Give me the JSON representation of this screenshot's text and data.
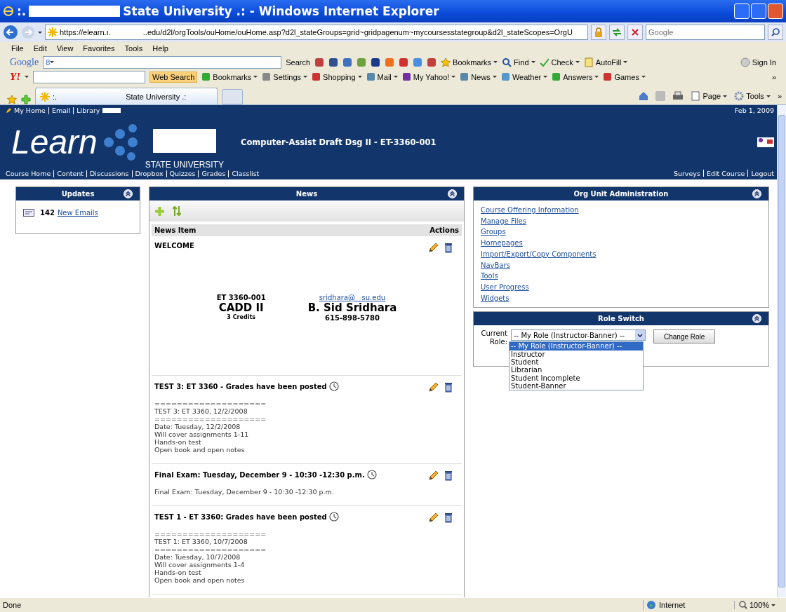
{
  "window": {
    "title_prefix": ":.",
    "title": "State University .: - Windows Internet Explorer"
  },
  "address_bar": {
    "url_start": "https://elearn.ı.",
    "url_rest": "..edu/d2l/orgTools/ouHome/ouHome.asp?d2l_stateGroups=grid~gridpagenum~mycoursesstategroup&d2l_stateScopes=OrgU",
    "search_placeholder": "Google"
  },
  "menu": [
    "File",
    "Edit",
    "View",
    "Favorites",
    "Tools",
    "Help"
  ],
  "google_toolbar": {
    "logo": "Google",
    "field_label": "8",
    "search": "Search",
    "items": [
      "Bookmarks",
      "Find",
      "Check",
      "AutoFill"
    ],
    "sign_in": "Sign In"
  },
  "yahoo_toolbar": {
    "logo": "Y!",
    "search": "Web Search",
    "items": [
      "Bookmarks",
      "Settings",
      "Shopping",
      "Mail",
      "My Yahoo!",
      "News",
      "Weather",
      "Answers",
      "Games"
    ],
    "more": "»"
  },
  "tabs": [
    {
      "prefix": ":.",
      "label": "State University .:",
      "selected": true
    }
  ],
  "command_bar": {
    "items": [
      "Page",
      "Tools"
    ],
    "more": "»"
  },
  "site_header": {
    "top_links": [
      "My Home",
      "Email",
      "Library"
    ],
    "date": "Feb 1, 2009",
    "logo": "Learn",
    "university": "STATE UNIVERSITY",
    "course_title": "Computer-Assist Draft Dsg II - ET-3360-001",
    "nav": [
      "Course Home",
      "Content",
      "Discussions",
      "Dropbox",
      "Quizzes",
      "Grades",
      "Classlist"
    ],
    "nav_right": [
      "Surveys",
      "Edit Course",
      "Logout"
    ]
  },
  "updates": {
    "title": "Updates",
    "count": "142",
    "link": "New Emails"
  },
  "news": {
    "title": "News",
    "columns": [
      "News Item",
      "Actions"
    ],
    "items": [
      {
        "kind": "welcome",
        "title": "WELCOME",
        "course_code": "ET 3360-001",
        "course_name": "CADD II",
        "credits": "3 Credits",
        "email": "sridhara@   su.edu",
        "instructor": "B. Sid Sridhara",
        "phone": "615-898-5780"
      },
      {
        "kind": "post",
        "title": "TEST 3: ET 3360 - Grades have been posted",
        "lines": [
          "====================",
          "TEST 3: ET 3360, 12/2/2008",
          "====================",
          "Date: Tuesday, 12/2/2008",
          "Will cover assignments 1-11",
          "Hands-on test",
          "Open book and open notes"
        ]
      },
      {
        "kind": "post",
        "title": "Final Exam: Tuesday, December 9 - 10:30 -12:30 p.m.",
        "lines": [
          "Final Exam: Tuesday, December 9 - 10:30 -12:30 p.m."
        ]
      },
      {
        "kind": "post",
        "title": "TEST 1 - ET 3360: Grades have been posted",
        "lines": [
          "====================",
          "TEST 1: ET 3360, 10/7/2008",
          "====================",
          "Date: Tuesday, 10/7/2008",
          "Will cover assignments 1-4",
          "Hands-on test",
          "Open book and open notes"
        ]
      }
    ]
  },
  "org_admin": {
    "title": "Org Unit Administration",
    "links": [
      "Course Offering Information",
      "Manage Files",
      "Groups",
      "Homepages",
      "Import/Export/Copy Components",
      "NavBars",
      "Tools",
      "User Progress",
      "Widgets"
    ]
  },
  "role_switch": {
    "title": "Role Switch",
    "label": "Current Role:",
    "value": "-- My Role (Instructor-Banner) --",
    "button": "Change Role",
    "options": [
      {
        "label": "-- My Role (Instructor-Banner) --",
        "selected": true
      },
      {
        "label": "Instructor",
        "selected": false
      },
      {
        "label": "Student",
        "selected": false
      },
      {
        "label": "Librarian",
        "selected": false
      },
      {
        "label": "Student Incomplete",
        "selected": false
      },
      {
        "label": "Student-Banner",
        "selected": false
      }
    ]
  },
  "status_bar": {
    "text": "Done",
    "zone": "Internet",
    "zoom": "100%"
  }
}
